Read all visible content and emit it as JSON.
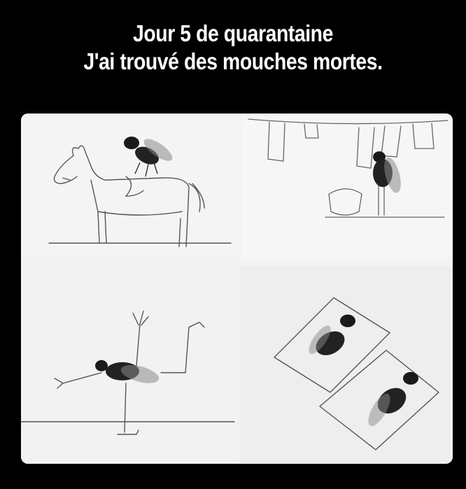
{
  "caption": {
    "line1": "Jour 5 de quarantaine",
    "line2": "J'ai trouvé des mouches mortes."
  },
  "colors": {
    "background": "#000000",
    "caption_text": "#ffffff",
    "paper": "#f3f3f3",
    "pencil": "#555555",
    "fly": "#1c1c1c"
  },
  "panels": [
    {
      "scene": "fly riding a horse"
    },
    {
      "scene": "fly hanging laundry on a clothesline"
    },
    {
      "scene": "fly ice skating"
    },
    {
      "scene": "two flies sunbathing on beach towels"
    }
  ]
}
